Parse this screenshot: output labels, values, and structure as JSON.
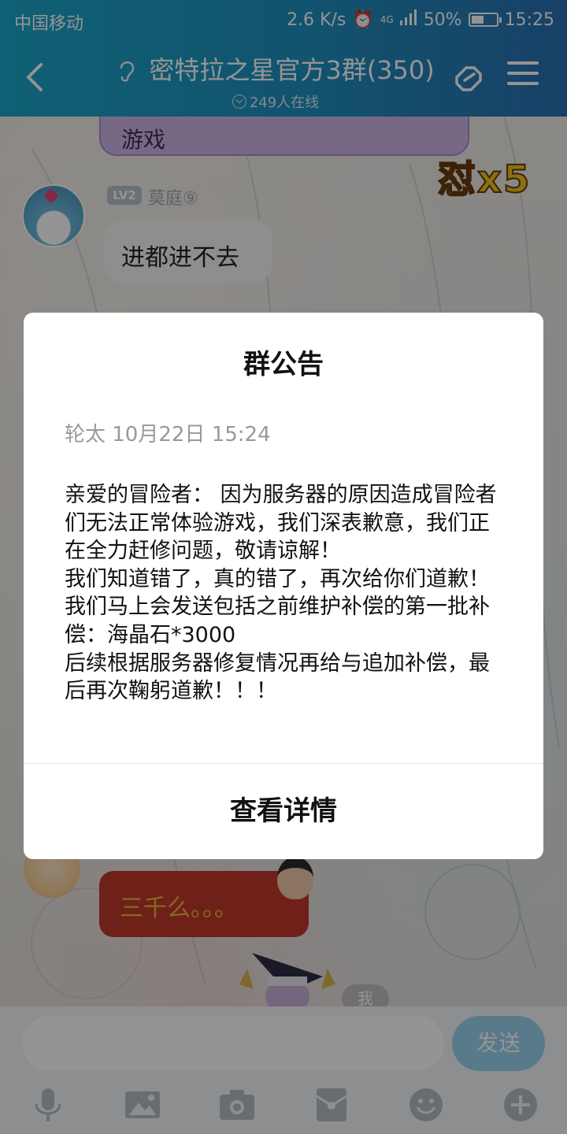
{
  "status_bar": {
    "carrier": "中国移动",
    "net_speed": "2.6 K/s",
    "network": "4G",
    "battery": "50%",
    "battery_level": 0.5,
    "time": "15:25"
  },
  "titlebar": {
    "title": "密特拉之星官方3群(350)",
    "online": "249人在线",
    "icons": [
      "back-arrow-icon",
      "ear-icon",
      "group-link-icon",
      "menu-icon"
    ]
  },
  "chat": {
    "messages": [
      {
        "sender": "",
        "text": "游戏",
        "style": "purple-bubble"
      },
      {
        "sender_level": "LV2",
        "sender": "莫庭⑨",
        "text": "进都进不去",
        "style": "white-bubble"
      },
      {
        "sender": "",
        "text": "三千么。。。",
        "style": "red-bubble"
      }
    ],
    "sticker_text": "怼x5",
    "me_tag": "我"
  },
  "input": {
    "placeholder": "",
    "send_label": "发送",
    "toolbar_icons": [
      "microphone-icon",
      "image-icon",
      "camera-icon",
      "red-packet-icon",
      "emoji-icon",
      "plus-icon"
    ]
  },
  "announcement": {
    "heading": "群公告",
    "author_time": "轮太  10月22日 15:24",
    "body": "亲爱的冒险者： 因为服务器的原因造成冒险者们无法正常体验游戏，我们深表歉意，我们正在全力赶修问题，敬请谅解！\n我们知道错了，真的错了，再次给你们道歉！\n我们马上会发送包括之前维护补偿的第一批补偿：海晶石*3000\n后续根据服务器修复情况再给与追加补偿，最后再次鞠躬道歉！！！",
    "details_button": "查看详情"
  },
  "colors": {
    "header_start": "#1ba6c8",
    "header_end": "#2a6fb0",
    "send_button": "#9ad3ee",
    "red_bubble": "#c0392b",
    "purple_bubble": "#cdb6e6"
  }
}
